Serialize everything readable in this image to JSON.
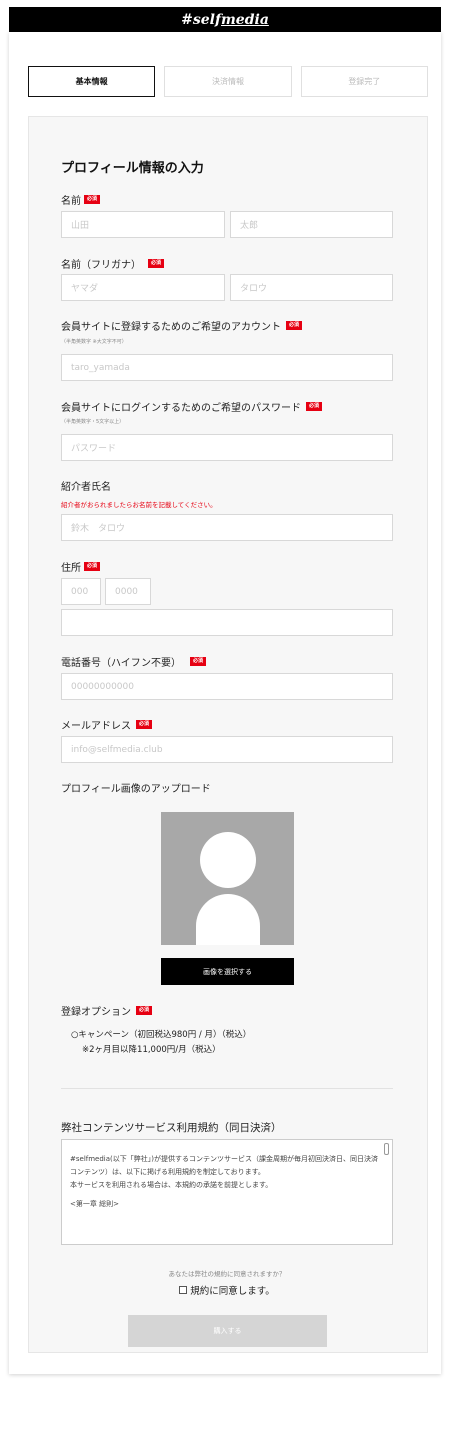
{
  "brand": {
    "prefix": "#self",
    "suffix": "media"
  },
  "steps": [
    "基本情報",
    "決済情報",
    "登録完了"
  ],
  "section_title": "プロフィール情報の入力",
  "required_badge": "必須",
  "name": {
    "label": "名前",
    "last_placeholder": "山田",
    "first_placeholder": "太郎"
  },
  "kana": {
    "label": "名前（フリガナ）",
    "last_placeholder": "ヤマダ",
    "first_placeholder": "タロウ"
  },
  "account": {
    "label": "会員サイトに登録するためのご希望のアカウント",
    "note": "（半角英数字 ※大文字不可）",
    "placeholder": "taro_yamada"
  },
  "password": {
    "label": "会員サイトにログインするためのご希望のパスワード",
    "note": "（半角英数字・5文字以上）",
    "placeholder": "パスワード"
  },
  "referrer": {
    "label": "紹介者氏名",
    "note": "紹介者がおられましたらお名前を記載してください。",
    "placeholder": "鈴木　タロウ"
  },
  "address": {
    "label": "住所",
    "zip1_placeholder": "000",
    "zip2_placeholder": "0000",
    "line_placeholder": ""
  },
  "phone": {
    "label": "電話番号（ハイフン不要）",
    "placeholder": "00000000000"
  },
  "email": {
    "label": "メールアドレス",
    "placeholder": "info@selfmedia.club"
  },
  "upload": {
    "label": "プロフィール画像のアップロード",
    "button": "画像を選択する"
  },
  "options": {
    "label": "登録オプション",
    "line1": "○キャンペーン（初回税込980円 / 月）（税込）",
    "line2": "※2ヶ月目以降11,000円/月（税込）"
  },
  "terms": {
    "title": "弊社コンテンツサービス利用規約（同日決済）",
    "p1": "#selfmedia(以下「弊社」)が提供するコンテンツサービス（課金周期が毎月初回決済日、同日決済コンテンツ）は、以下に掲げる利用規約を制定しております。",
    "p2": "本サービスを利用される場合は、本規約の承諾を前提とします。",
    "p3": "<第一章 総則>"
  },
  "agree": {
    "question": "あなたは弊社の規約に同意されますか？",
    "checkbox_label": "規約に同意します。"
  },
  "submit": {
    "label": "購入する"
  },
  "colors": {
    "required": "#e60012",
    "header": "#000000",
    "panel": "#f7f7f7",
    "submit_disabled": "#d5d5d5"
  }
}
